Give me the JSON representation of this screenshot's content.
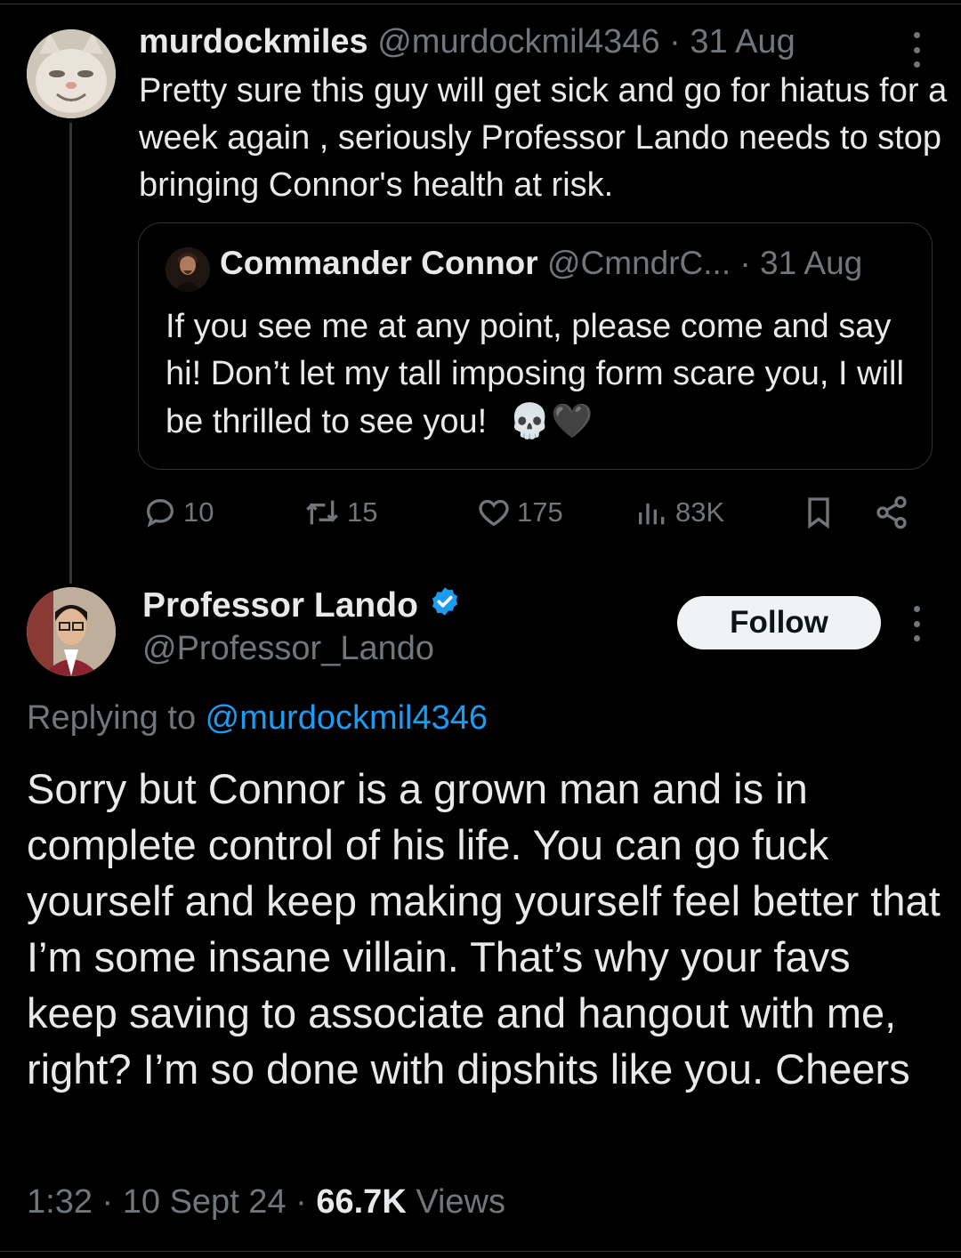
{
  "reply_tweet": {
    "author_name": "murdockmiles",
    "handle": "@murdockmil4346",
    "separator": " · ",
    "date": "31 Aug",
    "text": "Pretty sure this guy will get sick and  go for hiatus for a week again , seriously Professor Lando needs to stop bringing Connor's health at risk.",
    "quoted": {
      "author_name": "Commander Connor",
      "handle": "@CmndrC...",
      "separator": " · ",
      "date": "31 Aug",
      "text": "If you see me at any point, please come and say hi! Don’t let my tall imposing form scare you, I will be thrilled to see you!",
      "emojis": "💀🖤"
    },
    "stats": {
      "replies": "10",
      "reposts": "15",
      "likes": "175",
      "views": "83K"
    }
  },
  "main_tweet": {
    "author_name": "Professor Lando",
    "handle": "@Professor_Lando",
    "follow_label": "Follow",
    "replying_prefix": "Replying to ",
    "replying_handle": "@murdockmil4346",
    "text": "Sorry but Connor is a grown man and is in complete control of his life. You can go fuck yourself and keep making yourself feel better that I’m some insane villain. That’s why your favs keep saving to associate and hangout with me, right? I’m so done with dipshits like you. Cheers",
    "time": "1:32",
    "sep1": " · ",
    "date": "10 Sept 24",
    "sep2": " · ",
    "views_count": "66.7K",
    "views_label": " Views"
  },
  "colors": {
    "background": "#000000",
    "text": "#e7e9ea",
    "muted": "#71767b",
    "link": "#1d9bf0",
    "verified": "#1d9bf0",
    "follow_bg": "#eff3f4"
  },
  "icons": [
    "more-icon",
    "reply-icon",
    "repost-icon",
    "like-icon",
    "views-icon",
    "bookmark-icon",
    "share-icon",
    "verified-badge-icon"
  ]
}
